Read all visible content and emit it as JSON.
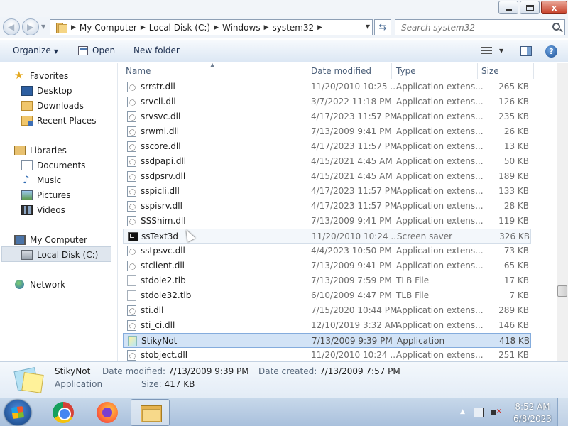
{
  "window": {
    "close_glyph": "x"
  },
  "address": {
    "crumbs": [
      "My Computer",
      "Local Disk (C:)",
      "Windows",
      "system32"
    ],
    "search_placeholder": "Search system32"
  },
  "toolbar": {
    "organize": "Organize",
    "open": "Open",
    "new_folder": "New folder"
  },
  "navigation": {
    "favorites": "Favorites",
    "desktop": "Desktop",
    "downloads": "Downloads",
    "recent_places": "Recent Places",
    "libraries": "Libraries",
    "documents": "Documents",
    "music": "Music",
    "pictures": "Pictures",
    "videos": "Videos",
    "my_computer": "My Computer",
    "local_disk": "Local Disk (C:)",
    "network": "Network",
    "selected": "Local Disk (C:)"
  },
  "columns": {
    "name": "Name",
    "date_modified": "Date modified",
    "type": "Type",
    "size": "Size"
  },
  "files": [
    {
      "name": "srrstr.dll",
      "date": "11/20/2010 10:25 ...",
      "type": "Application extens...",
      "size": "265 KB",
      "icon": "dll"
    },
    {
      "name": "srvcli.dll",
      "date": "3/7/2022 11:18 PM",
      "type": "Application extens...",
      "size": "126 KB",
      "icon": "dll"
    },
    {
      "name": "srvsvc.dll",
      "date": "4/17/2023 11:57 PM",
      "type": "Application extens...",
      "size": "235 KB",
      "icon": "dll"
    },
    {
      "name": "srwmi.dll",
      "date": "7/13/2009 9:41 PM",
      "type": "Application extens...",
      "size": "26 KB",
      "icon": "dll"
    },
    {
      "name": "sscore.dll",
      "date": "4/17/2023 11:57 PM",
      "type": "Application extens...",
      "size": "13 KB",
      "icon": "dll"
    },
    {
      "name": "ssdpapi.dll",
      "date": "4/15/2021 4:45 AM",
      "type": "Application extens...",
      "size": "50 KB",
      "icon": "dll"
    },
    {
      "name": "ssdpsrv.dll",
      "date": "4/15/2021 4:45 AM",
      "type": "Application extens...",
      "size": "189 KB",
      "icon": "dll"
    },
    {
      "name": "sspicli.dll",
      "date": "4/17/2023 11:57 PM",
      "type": "Application extens...",
      "size": "133 KB",
      "icon": "dll"
    },
    {
      "name": "sspisrv.dll",
      "date": "4/17/2023 11:57 PM",
      "type": "Application extens...",
      "size": "28 KB",
      "icon": "dll"
    },
    {
      "name": "SSShim.dll",
      "date": "7/13/2009 9:41 PM",
      "type": "Application extens...",
      "size": "119 KB",
      "icon": "dll"
    },
    {
      "name": "ssText3d",
      "date": "11/20/2010 10:24 ...",
      "type": "Screen saver",
      "size": "326 KB",
      "icon": "scr",
      "state": "hover"
    },
    {
      "name": "sstpsvc.dll",
      "date": "4/4/2023 10:50 PM",
      "type": "Application extens...",
      "size": "73 KB",
      "icon": "dll"
    },
    {
      "name": "stclient.dll",
      "date": "7/13/2009 9:41 PM",
      "type": "Application extens...",
      "size": "65 KB",
      "icon": "dll"
    },
    {
      "name": "stdole2.tlb",
      "date": "7/13/2009 7:59 PM",
      "type": "TLB File",
      "size": "17 KB",
      "icon": "tlb"
    },
    {
      "name": "stdole32.tlb",
      "date": "6/10/2009 4:47 PM",
      "type": "TLB File",
      "size": "7 KB",
      "icon": "tlb"
    },
    {
      "name": "sti.dll",
      "date": "7/15/2020 10:44 PM",
      "type": "Application extens...",
      "size": "289 KB",
      "icon": "dll"
    },
    {
      "name": "sti_ci.dll",
      "date": "12/10/2019 3:32 AM",
      "type": "Application extens...",
      "size": "146 KB",
      "icon": "dll"
    },
    {
      "name": "StikyNot",
      "date": "7/13/2009 9:39 PM",
      "type": "Application",
      "size": "418 KB",
      "icon": "app",
      "state": "selected"
    },
    {
      "name": "stobject.dll",
      "date": "11/20/2010 10:24 ...",
      "type": "Application extens...",
      "size": "251 KB",
      "icon": "dll"
    }
  ],
  "details": {
    "name": "StikyNot",
    "type": "Application",
    "date_modified_label": "Date modified:",
    "date_modified": "7/13/2009 9:39 PM",
    "date_created_label": "Date created:",
    "date_created": "7/13/2009 7:57 PM",
    "size_label": "Size:",
    "size": "417 KB"
  },
  "taskbar": {
    "apps": [
      "Google Chrome",
      "Firefox",
      "Windows Explorer"
    ],
    "time": "8:52 AM",
    "date": "6/8/2023"
  }
}
